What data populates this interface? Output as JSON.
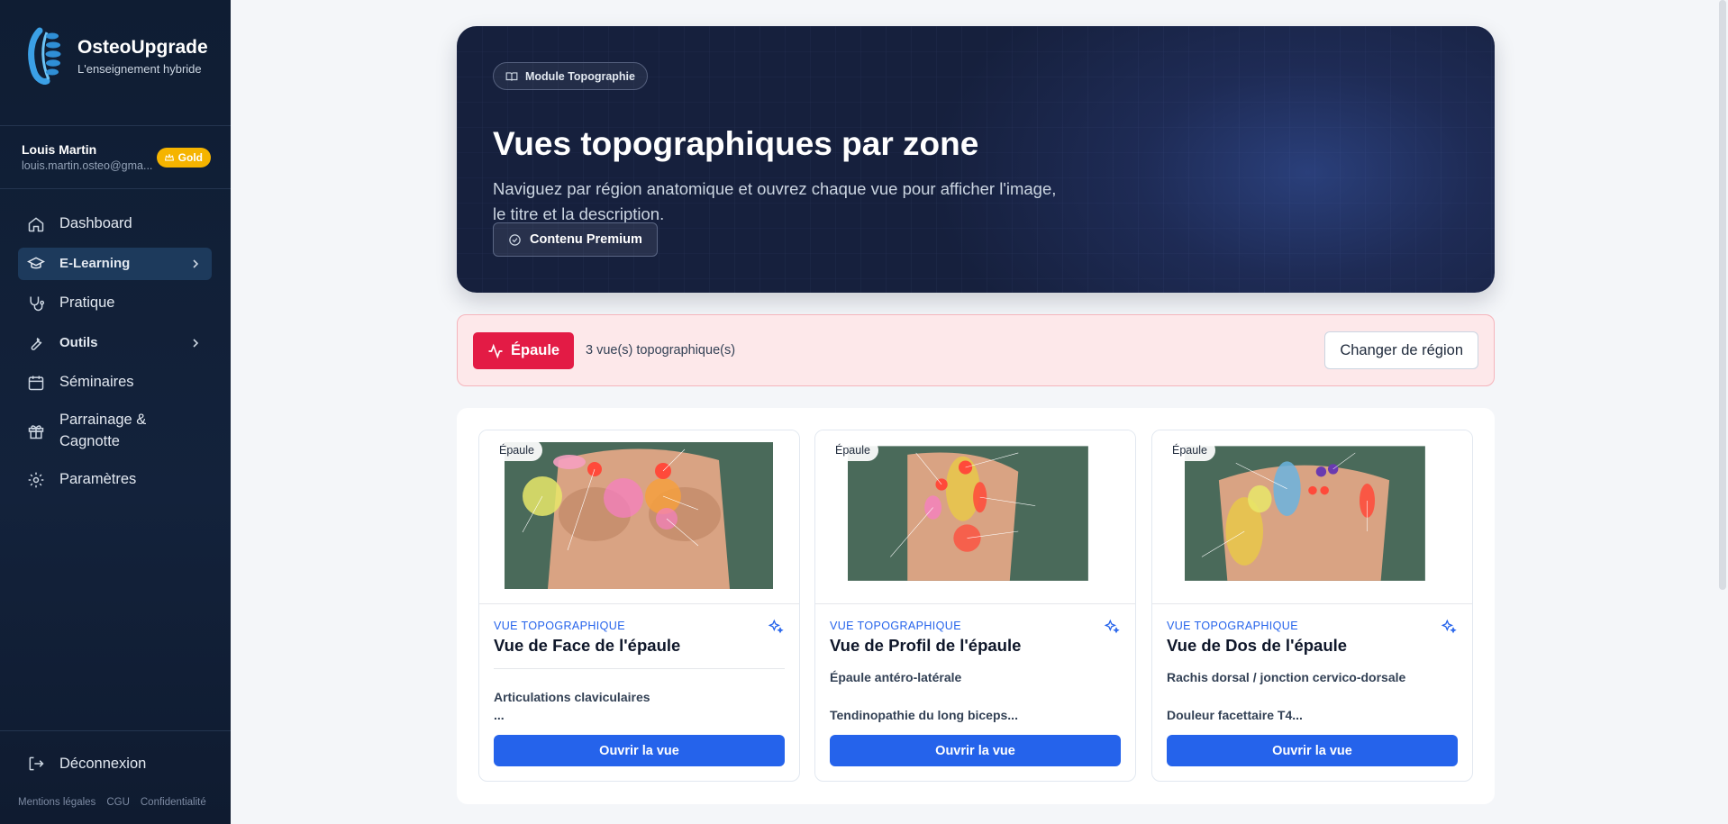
{
  "brand": {
    "name": "OsteoUpgrade",
    "tagline": "L'enseignement hybride"
  },
  "user": {
    "name": "Louis Martin",
    "email": "louis.martin.osteo@gma...",
    "badge": "Gold"
  },
  "nav": [
    {
      "label": "Dashboard",
      "icon": "home-icon"
    },
    {
      "label": "E-Learning",
      "icon": "graduation-cap-icon",
      "active": true
    },
    {
      "label": "Pratique",
      "icon": "stethoscope-icon"
    },
    {
      "label": "Outils",
      "icon": "wrench-icon"
    },
    {
      "label": "Séminaires",
      "icon": "calendar-icon"
    },
    {
      "label": "Parrainage &",
      "label2": "Cagnotte",
      "icon": "gift-icon"
    },
    {
      "label": "Paramètres",
      "icon": "gear-icon"
    }
  ],
  "logout": "Déconnexion",
  "footer": [
    "Mentions légales",
    "CGU",
    "Confidentialité"
  ],
  "hero": {
    "chip": "Module Topographie",
    "title": "Vues topographiques par zone",
    "desc_line1": "Naviguez par région anatomique et ouvrez chaque vue pour afficher l'image,",
    "desc_line2": "le titre et la description.",
    "button": "Contenu Premium"
  },
  "region": {
    "name": "Épaule",
    "count": "3 vue(s) topographique(s)",
    "change": "Changer de région"
  },
  "cards": [
    {
      "tag": "Épaule",
      "kicker": "VUE TOPOGRAPHIQUE",
      "title": "Vue de Face de l'épaule",
      "subtitle": "",
      "text": "Articulations claviculaires",
      "text2": "...",
      "button": "Ouvrir la vue"
    },
    {
      "tag": "Épaule",
      "kicker": "VUE TOPOGRAPHIQUE",
      "title": "Vue de Profil de l'épaule",
      "subtitle": "Épaule antéro-latérale",
      "text": "Tendinopathie du long biceps...",
      "button": "Ouvrir la vue"
    },
    {
      "tag": "Épaule",
      "kicker": "VUE TOPOGRAPHIQUE",
      "title": "Vue de Dos de l'épaule",
      "subtitle": "Rachis dorsal / jonction cervico-dorsale",
      "text": "Douleur facettaire T4...",
      "button": "Ouvrir la vue"
    }
  ],
  "colors": {
    "accent": "#2563eb",
    "region": "#e31b45",
    "gold": "#f5b400",
    "sidebar": "#0f1d33"
  }
}
